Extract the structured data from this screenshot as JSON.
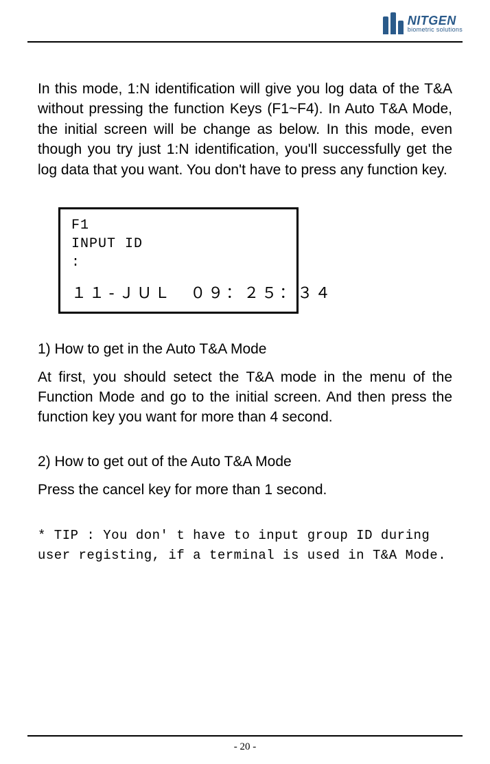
{
  "header": {
    "brand_main": "NITGEN",
    "brand_sub": "biometric solutions"
  },
  "intro": "In this mode, 1:N identification will give you log data of the T&A without pressing the function Keys (F1~F4).   In Auto T&A Mode, the initial screen will be change as below. In this mode, even though you try just 1:N identification, you'll successfully get the log data that you want. You don't have to press any function key.",
  "lcd": {
    "line1": "F1",
    "line2": "INPUT ID",
    "line3": ":",
    "datetime": "１１-ＪＵＬ　０９：２５：３４"
  },
  "sections": {
    "s1_heading": "1) How to get in the Auto T&A Mode",
    "s1_body": "At first, you should setect the T&A mode in the menu of the Function Mode and go to the initial screen. And then press the function key you want for more than 4 second.",
    "s2_heading": "2) How to get out of the Auto T&A Mode",
    "s2_body": "Press the cancel key for more than 1 second."
  },
  "tip": "* TIP : You don' t have to input group ID during user registing, if a terminal is used in T&A Mode.",
  "page_number": "- 20 -"
}
